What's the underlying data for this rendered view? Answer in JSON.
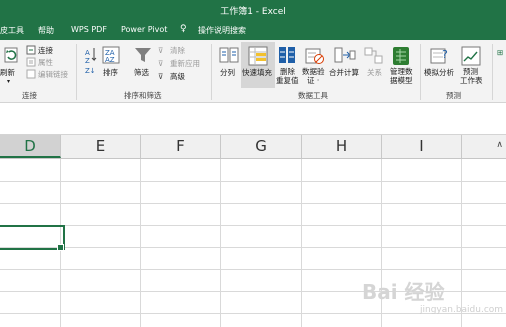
{
  "window": {
    "title": "工作簿1  -  Excel"
  },
  "menu": {
    "tabs": [
      "皮工具",
      "帮助",
      "WPS PDF",
      "Power Pivot",
      "操作说明搜索"
    ]
  },
  "ribbon": {
    "connections": {
      "refresh_label": "刷新",
      "connections": "连接",
      "properties": "属性",
      "edit_links": "编辑链接",
      "group_label": "连接"
    },
    "sort_filter": {
      "sort": "排序",
      "filter": "筛选",
      "clear": "清除",
      "reapply": "重新应用",
      "advanced": "高级",
      "group_label": "排序和筛选"
    },
    "data_tools": {
      "text_to_columns": "分列",
      "flash_fill": "快速填充",
      "remove_dup_1": "删除",
      "remove_dup_2": "重复值",
      "validation_1": "数据验",
      "validation_2": "证 ·",
      "consolidate": "合并计算",
      "relationships": "关系",
      "model_1": "管理数",
      "model_2": "据模型",
      "group_label": "数据工具"
    },
    "forecast": {
      "what_if": "模拟分析",
      "sheet_1": "预测",
      "sheet_2": "工作表",
      "group_label": "预测"
    }
  },
  "sheet": {
    "columns": [
      "D",
      "E",
      "F",
      "G",
      "H",
      "I"
    ],
    "selected_column": "D"
  },
  "watermark": {
    "main": "Bai 经验",
    "sub": "jingyan.baidu.com"
  },
  "colors": {
    "accent": "#217346",
    "ribbon_bg": "#f3f3f3",
    "header_bg": "#f0f0f0",
    "grid": "#d9d9d9"
  }
}
